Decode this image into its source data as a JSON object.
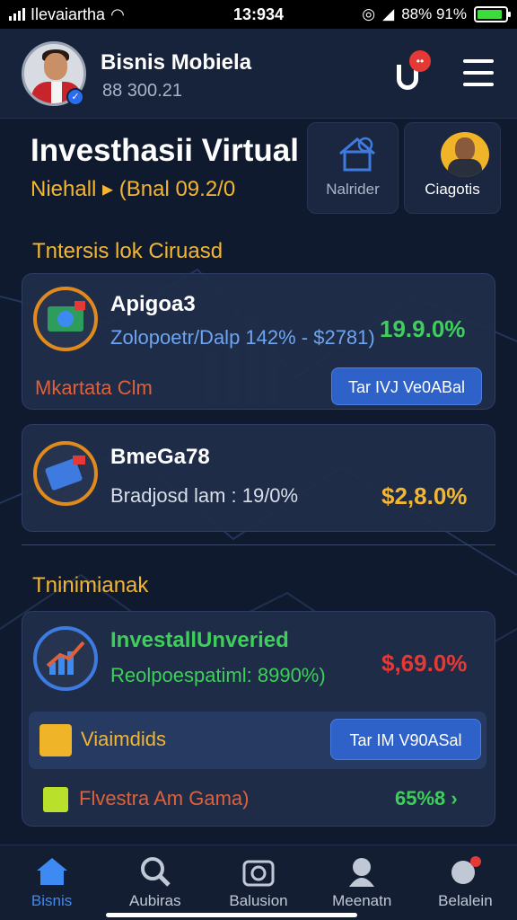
{
  "status_bar": {
    "carrier": "Ilevaiartha",
    "time": "13:934",
    "battery_text": "88% 91%",
    "battery_level": 0.91
  },
  "header": {
    "user_name": "Bisnis Mobiela",
    "user_balance": "88 300.21",
    "notification_count": "••"
  },
  "hero": {
    "title": "Investhasii Virtual",
    "subtitle_left": "Niehall ▸",
    "subtitle_right": "(Bnal 09.2/0"
  },
  "quick_actions": [
    {
      "label": "Nalrider",
      "icon": "house-chart-icon"
    },
    {
      "label": "Ciagotis",
      "icon": "profile-icon"
    }
  ],
  "section1": {
    "title": "Tntersis lok Ciruasd"
  },
  "investments": [
    {
      "name": "Apigoa3",
      "detail": "Zolopoetr/Dalp 142% - $2781)",
      "percent": "19.9.0%",
      "tag": "Mkartata Clm",
      "button": "Tar IVJ Ve0ABal"
    },
    {
      "name": "BmeGa78",
      "detail": "Bradjosd lam : 19/0%",
      "percent": "$2,8.0%"
    }
  ],
  "section2": {
    "title": "Tninimianak"
  },
  "featured": {
    "name": "InvestallUnveried",
    "detail": "Reolpoespatiml: 8990%)",
    "percent": "$,69.0%",
    "sub_label": "Viaimdids",
    "sub_button": "Tar IM V90ASal",
    "footer_label": "Flvestra Am Gama)",
    "footer_value": "65%8 ›"
  },
  "bottom_nav": [
    {
      "label": "Bisnis",
      "icon": "home-icon",
      "active": true
    },
    {
      "label": "Aubiras",
      "icon": "search-icon",
      "active": false
    },
    {
      "label": "Balusion",
      "icon": "camera-icon",
      "active": false
    },
    {
      "label": "Meenatn",
      "icon": "character-icon",
      "active": false
    },
    {
      "label": "Belalein",
      "icon": "profile-badge-icon",
      "active": false
    }
  ],
  "colors": {
    "background": "#101a2e",
    "accent_gold": "#f2b632",
    "accent_blue": "#2f62c8",
    "positive_green": "#3ecf5a",
    "negative_red": "#e53935"
  }
}
